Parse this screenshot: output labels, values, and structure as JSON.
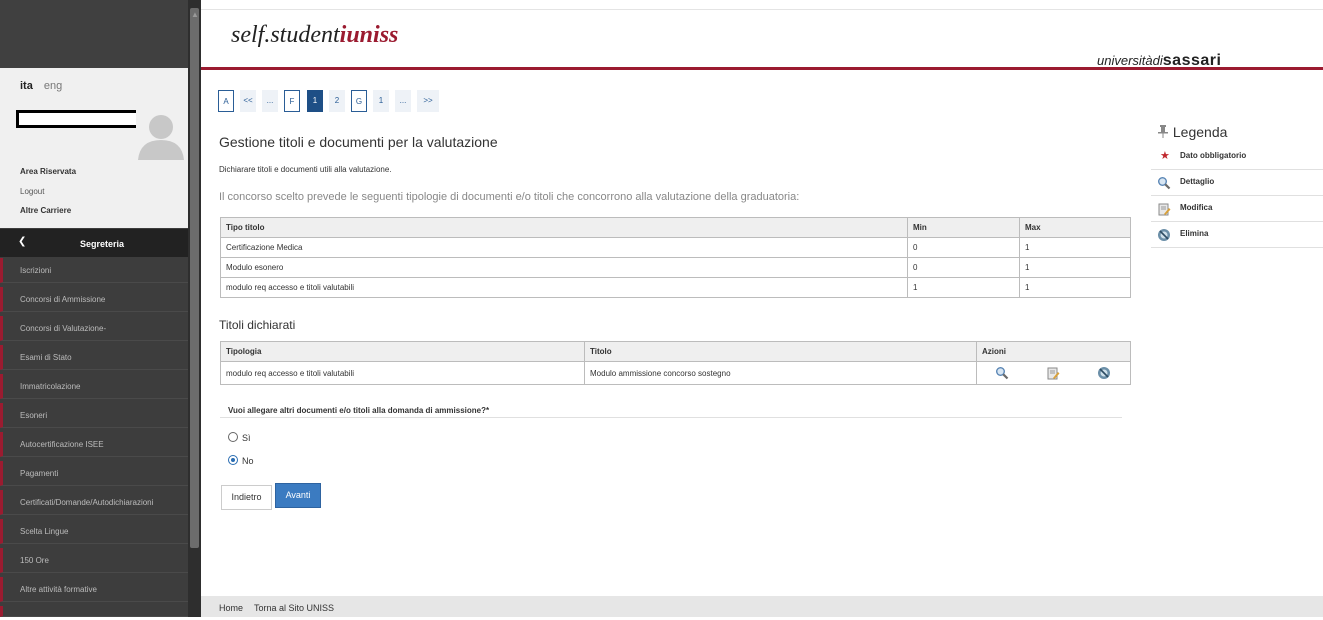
{
  "sidebar": {
    "lang_ita": "ita",
    "lang_eng": "eng",
    "area_riservata": "Area Riservata",
    "logout": "Logout",
    "altre_carriere": "Altre Carriere",
    "section_title": "Segreteria",
    "items": [
      "Iscrizioni",
      "Concorsi di Ammissione",
      "Concorsi di Valutazione-",
      "Esami di Stato",
      "Immatricolazione",
      "Esoneri",
      "Autocertificazione ISEE",
      "Pagamenti",
      "Certificati/Domande/Autodichiarazioni",
      "Scelta Lingue",
      "150 Ore",
      "Altre attività formative"
    ]
  },
  "header": {
    "logo_prefix": "self.student",
    "logo_bold": "iuniss",
    "uni_prefix": "universitàdi",
    "uni_bold": "sassari"
  },
  "pager": [
    "A",
    "<<",
    "...",
    "F",
    "1",
    "2",
    "G",
    "1",
    "...",
    ">>"
  ],
  "main": {
    "title": "Gestione titoli e documenti per la valutazione",
    "subtitle": "Dichiarare titoli e documenti utili alla valutazione.",
    "intro": "Il concorso scelto prevede le seguenti tipologie di documenti e/o titoli che concorrono alla valutazione della graduatoria:",
    "table1": {
      "headers": [
        "Tipo titolo",
        "Min",
        "Max"
      ],
      "rows": [
        [
          "Certificazione Medica",
          "0",
          "1"
        ],
        [
          "Modulo esonero",
          "0",
          "1"
        ],
        [
          "modulo req accesso e titoli valutabili",
          "1",
          "1"
        ]
      ]
    },
    "section2_title": "Titoli dichiarati",
    "table2": {
      "headers": [
        "Tipologia",
        "Titolo",
        "Azioni"
      ],
      "rows": [
        [
          "modulo req accesso e titoli valutabili",
          "Modulo ammissione concorso sostegno"
        ]
      ]
    },
    "question": "Vuoi allegare altri documenti e/o titoli alla domanda di ammissione?*",
    "option_yes": "Sì",
    "option_no": "No",
    "selected": "No",
    "btn_back": "Indietro",
    "btn_next": "Avanti"
  },
  "legend": {
    "title": "Legenda",
    "items": [
      "Dato obbligatorio",
      "Dettaglio",
      "Modifica",
      "Elimina"
    ]
  },
  "footer": {
    "home": "Home",
    "back_site": "Torna al Sito UNISS"
  },
  "colors": {
    "brand_red": "#9b1b30",
    "accent_blue": "#3b7bc1",
    "sidebar_dark": "#3d3d3d"
  }
}
